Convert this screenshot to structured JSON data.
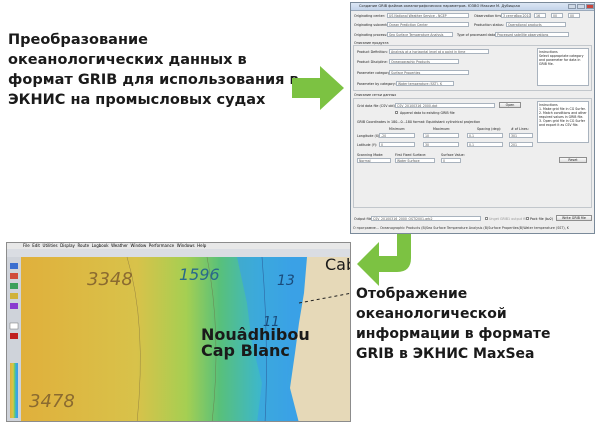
{
  "captions": {
    "top": "Преобразование океанологических данных в формат GRIB для использования в ЭКНИС на промысловых судах",
    "bottom": "Отображение океанологической информации в формате GRIB в ЭКНИС MaxSea"
  },
  "converter": {
    "title": "Создание GRIB файлов океанографических параметров. ЮЗВО Максим М. Дубицкая",
    "org_label": "Originating center:",
    "org_value": "US National Weather Service - NCEP",
    "obs_time_label": "Observation time:",
    "obs_date": "3 сентября 2010 г.",
    "obs_hour": "16",
    "obs_min": "00",
    "obs_sec": "00",
    "subcenter_label": "Originating subcenter:",
    "subcenter_value": "Ocean Prediction Center",
    "prod_status_label": "Production status:",
    "prod_status_value": "Operational products",
    "process_label": "Originating process:",
    "process_value": "Sea Surface Temperature Analysis",
    "type_label": "Type of processed data:",
    "type_value": "Processed satellite observations",
    "product_section": "Описание продукта",
    "discipline_label": "Product Definition:",
    "discipline_value": "Analysis at a horizontal level at a point in time",
    "prod_discipline_label": "Product Discipline:",
    "prod_discipline_value": "Oceanographic Products",
    "param_cat_label": "Parameter category:",
    "param_cat_value": "Surface Properties",
    "param_label": "Parameter by category:",
    "param_value": "Water temperature (SST), K",
    "instructions_1_title": "Instructions",
    "instructions_1_text": "Select appropriate category and parameter for data in GRIB file.",
    "grid_section": "Описание сетки данных",
    "datafile_label": "Grid data file (CSV old):",
    "datafile_value": "CSV_20100316_2000.dat",
    "open_label": "Open",
    "append_label": "Append data to existing GRIB file",
    "gds_label": "GRIB Coordinates in 180...0...180 format: Equidistant cylindrical projection",
    "col_min": "Minimum:",
    "col_max": "Maximum:",
    "col_spacing": "Spacing (deg):",
    "col_lines": "# of Lines:",
    "lon_label": "Longitude (X):",
    "lon_min": "-20",
    "lon_max": "10",
    "lon_spacing": "0.1",
    "lon_lines": "301",
    "lat_label": "Latitude (Y):",
    "lat_min": "0",
    "lat_max": "30",
    "lat_spacing": "0.1",
    "lat_lines": "201",
    "scan_label": "Scanning Mode:",
    "scan_value": "Normal",
    "fixed_label": "First Fixed Surface:",
    "fixed_value": "Water Surface",
    "surface_label": "Surface Value:",
    "surface_value": "0",
    "instructions_2_title": "Instructions",
    "instructions_2_text": "1. Make grid file in CG Surfer. 2. Match conditions and other required values in GRIB file. 3. Open grid file in CG Surfer and export it as CSV file.",
    "reset_label": "Reset",
    "output_label": "Output file:",
    "output_value": "CSV_20100316_2000_OSTI2001.grb2",
    "ungrib_label": "Unget GRIB1 output file",
    "pack_label": "Pack file (bz2)",
    "write_label": "Write GRIB file",
    "status": "О программе... Oceanographic Products (B)Sea Surface Temperature Analysis (B)Surface Properties(B)Water temperature (SST), K"
  },
  "maxsea": {
    "menu": [
      "File",
      "Edit",
      "Utilities",
      "Display",
      "Route",
      "Logbook",
      "Weather",
      "Window",
      "Performance",
      "Windows",
      "Help"
    ],
    "place_labels": [
      "Nouâdhibou",
      "Cap Blanc",
      "Cab"
    ],
    "depth_numbers": [
      "3348",
      "1596",
      "3478",
      "13",
      "11"
    ],
    "colors": {
      "warm": "#e2b93f",
      "cool": "#3aa1e6",
      "water_mid": "#8fcf55",
      "land": "#d2b48c"
    }
  }
}
